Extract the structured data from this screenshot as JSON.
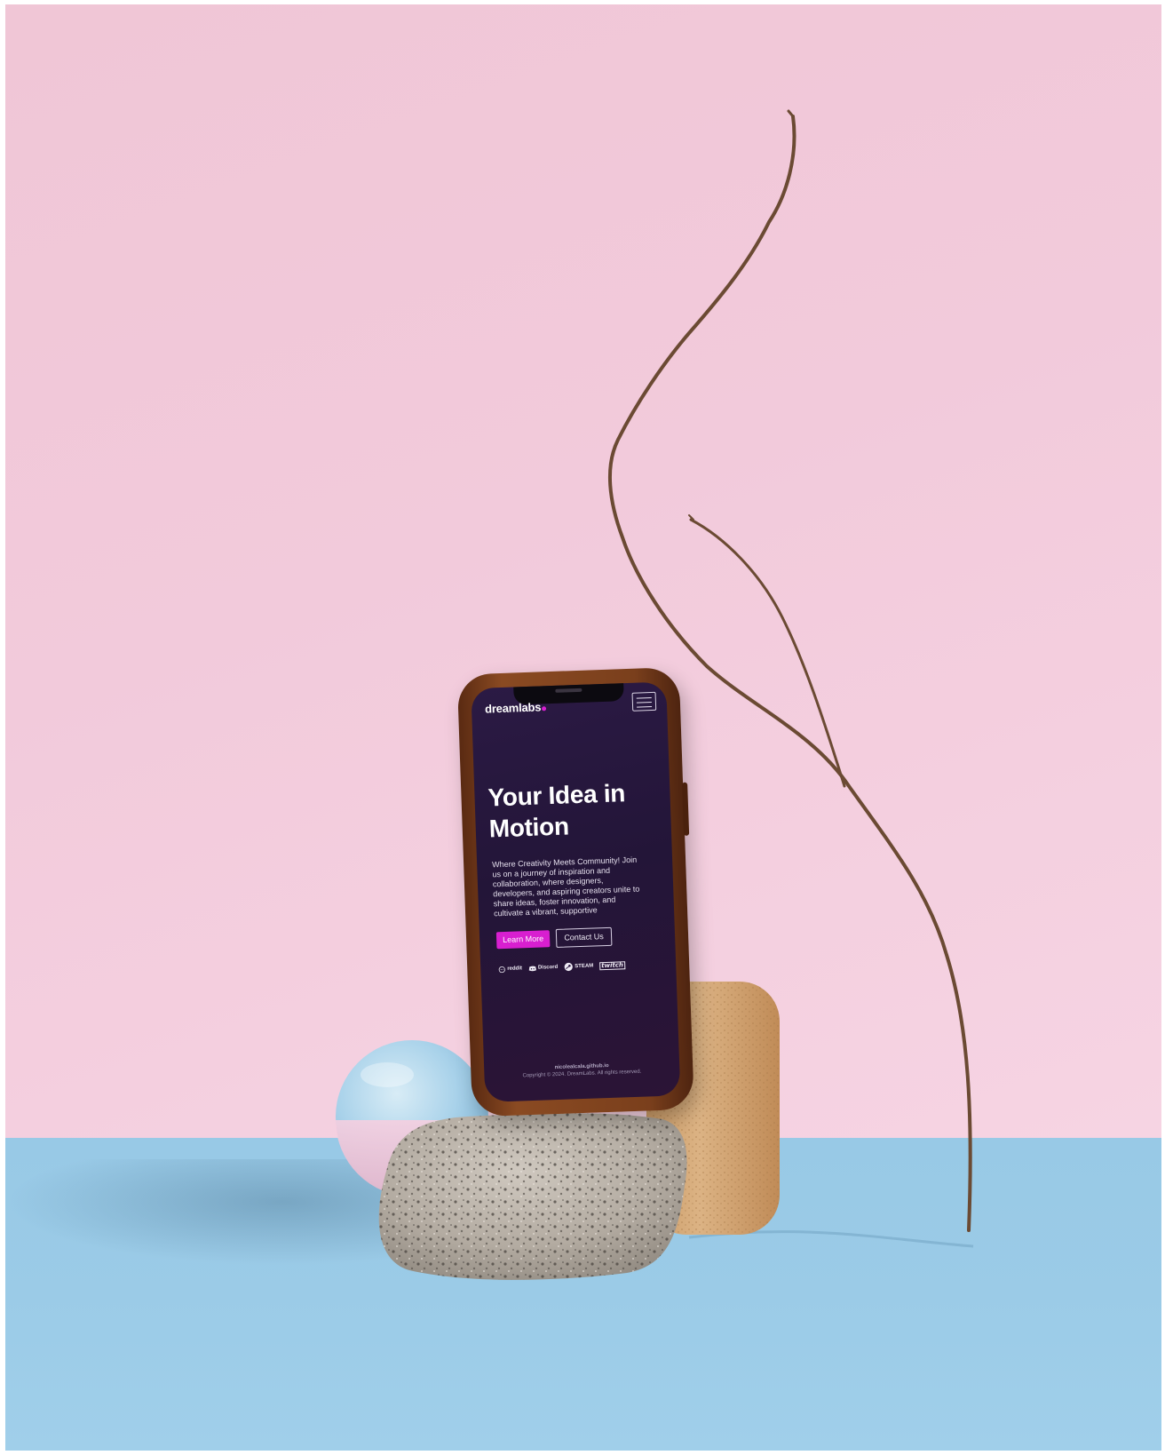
{
  "scene": {
    "wall_color": "#f2cadb",
    "floor_color": "#9bcbe7"
  },
  "site": {
    "brand": "dreamlabs",
    "accent_color": "#d81fd0",
    "menu_icon": "hamburger-icon",
    "hero": {
      "title": "Your Idea in Motion",
      "description": "Where Creativity Meets Community! Join us on a journey of inspiration and collaboration, where designers, developers, and aspiring creators unite to share ideas, foster innovation, and cultivate a vibrant, supportive"
    },
    "buttons": {
      "primary": "Learn More",
      "secondary": "Contact Us"
    },
    "partners": [
      {
        "name": "reddit",
        "icon": "reddit-icon"
      },
      {
        "name": "Discord",
        "icon": "discord-icon"
      },
      {
        "name": "STEAM",
        "icon": "steam-icon"
      },
      {
        "name": "twitch",
        "icon": "twitch-icon"
      }
    ],
    "footer": {
      "site": "nicolealcala.github.io",
      "copyright": "Copyright © 2024. DreamLabs. All rights reserved."
    }
  }
}
